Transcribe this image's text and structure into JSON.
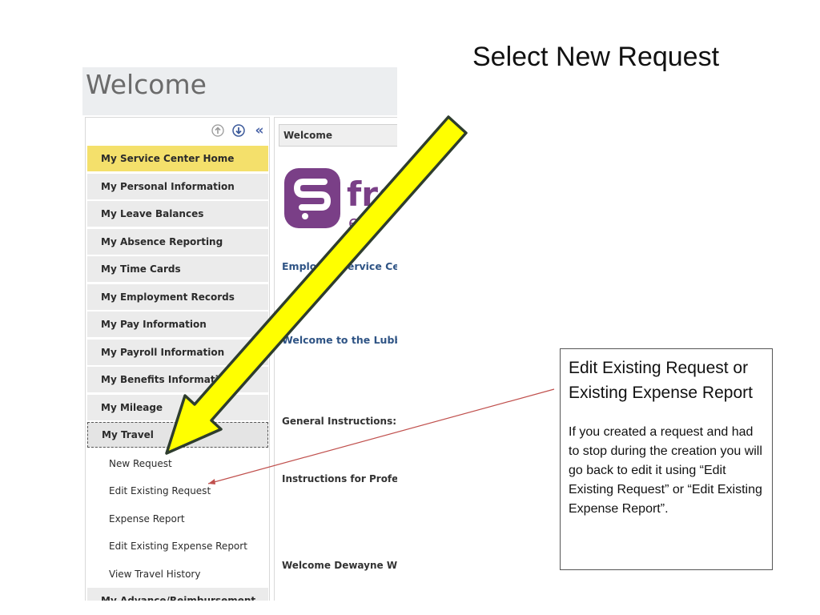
{
  "slide": {
    "title": "Select New Request"
  },
  "portal": {
    "welcome_heading": "Welcome",
    "tools": [
      "scroll-up-icon",
      "scroll-down-icon",
      "collapse-icon"
    ],
    "menu": [
      {
        "label": "My Service Center Home",
        "state": "active"
      },
      {
        "label": "My Personal Information"
      },
      {
        "label": "My Leave Balances"
      },
      {
        "label": "My Absence Reporting"
      },
      {
        "label": "My Time Cards"
      },
      {
        "label": "My Employment Records"
      },
      {
        "label": "My Pay Information"
      },
      {
        "label": "My Payroll Information"
      },
      {
        "label": "My Benefits Information"
      },
      {
        "label": "My Mileage"
      },
      {
        "label": "My Travel",
        "state": "open"
      }
    ],
    "travel_submenu": [
      "New Request",
      "Edit Existing Request",
      "Expense Report",
      "Edit Existing Expense Report",
      "View Travel History"
    ],
    "next_menu_item": "My Advance/Reimbursement",
    "content": {
      "tab": "Welcome",
      "logo_text": "fro",
      "logo_sub": "edu",
      "lines": [
        "Employee Service Cen",
        "Welcome to the Lubbo",
        "General Instructions:",
        "Instructions for Professio",
        "Welcome Dewayne Wilkin"
      ]
    }
  },
  "callout": {
    "title": "Edit Existing Request or Existing Expense Report",
    "body": "If you created a request and had to stop during the creation you will go back to edit it using “Edit Existing Request” or “Edit Existing Expense Report”."
  },
  "colors": {
    "arrow_fill": "#ffff00",
    "arrow_stroke": "#2e3d2e",
    "pointer_line": "#c0504d",
    "active_item": "#f4e06b",
    "logo_purple": "#7a3f87",
    "link_blue": "#2f5485"
  }
}
